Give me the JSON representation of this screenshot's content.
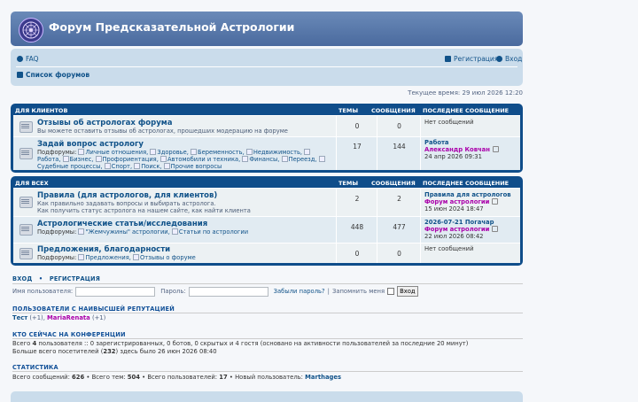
{
  "site": {
    "title": "Форум Предсказательной Астрологии"
  },
  "nav": {
    "faq": "FAQ",
    "register": "Регистрация",
    "login": "Вход",
    "forum_index": "Список форумов"
  },
  "current_time": "Текущее время: 29 июл 2026 12:20",
  "columns": {
    "topics": "ТЕМЫ",
    "posts": "СООБЩЕНИЯ",
    "last_post": "ПОСЛЕДНЕЕ СООБЩЕНИЕ"
  },
  "categories": [
    {
      "name": "ДЛЯ КЛИЕНТОВ",
      "forums": [
        {
          "title": "Отзывы об астрологах форума",
          "desc": "Вы можете оставить отзывы об астрологах, прошедших модерацию на форуме",
          "topics": "0",
          "posts": "0",
          "last": {
            "none": "Нет сообщений"
          }
        },
        {
          "title": "Задай вопрос астрологу",
          "subforums_label": "Подфорумы:",
          "subforums": [
            "Личные отношения,",
            "Здоровье,",
            "Беременность,",
            "Недвижимость,",
            "Работа,",
            "Бизнес,",
            "Профориентация,",
            "Автомобили и техника,",
            "Финансы,",
            "Переезд,",
            "Судебные процессы,",
            "Спорт,",
            "Поиск,",
            "Прочие вопросы"
          ],
          "topics": "17",
          "posts": "144",
          "last": {
            "topic": "Работа",
            "user": "Александр Ковчан",
            "date": "24 апр 2026 09:31"
          }
        }
      ]
    },
    {
      "name": "ДЛЯ ВСЕХ",
      "forums": [
        {
          "title": "Правила (для астрологов, для клиентов)",
          "desc": "Как правильно задавать вопросы и выбирать астролога.",
          "desc2": "Как получить статус астролога на нашем сайте, как найти клиента",
          "topics": "2",
          "posts": "2",
          "last": {
            "topic": "Правила для астрологов",
            "user": "Форум астрологии",
            "date": "15 июн 2024 18:47"
          }
        },
        {
          "title": "Астрологические статьи/исследования",
          "subforums_label": "Подфорумы:",
          "subforums": [
            "\"Жемчужины\" астрологии,",
            "Статьи по астрологии"
          ],
          "topics": "448",
          "posts": "477",
          "last": {
            "topic": "2026-07-21 Погачар",
            "user": "Форум астрологии",
            "date": "22 июл 2026 08:42"
          }
        },
        {
          "title": "Предложения, благодарности",
          "subforums_label": "Подфорумы:",
          "subforums": [
            "Предложения,",
            "Отзывы о форуме"
          ],
          "topics": "0",
          "posts": "0",
          "last": {
            "none": "Нет сообщений"
          }
        }
      ]
    }
  ],
  "login_box": {
    "login": "ВХОД",
    "dot": "•",
    "register": "РЕГИСТРАЦИЯ",
    "username_label": "Имя пользователя:",
    "password_label": "Пароль:",
    "forgot": "Забыли пароль?",
    "pipe": "|",
    "remember": "Запомнить меня",
    "submit": "Вход"
  },
  "reputation": {
    "heading": "ПОЛЬЗОВАТЕЛИ С НАИВЫСШЕЙ РЕПУТАЦИЕЙ",
    "user1": "Тест",
    "score1": "(+1),",
    "user2": "MariaRenata",
    "score2": "(+1)"
  },
  "online": {
    "heading": "КТО СЕЙЧАС НА КОНФЕРЕНЦИИ",
    "line1_a": "Всего",
    "line1_count": "4",
    "line1_b": "пользователя :: 0 зарегистрированных, 0 ботов, 0 скрытых и 4 гостя (основано на активности пользователей за последние 20 минут)",
    "line2_a": "Больше всего посетителей (",
    "line2_count": "232",
    "line2_b": ") здесь было 26 июн 2026 08:40"
  },
  "stats": {
    "heading": "СТАТИСТИКА",
    "posts_label": "Всего сообщений:",
    "posts": "626",
    "topics_label": "• Всего тем:",
    "topics": "504",
    "users_label": "• Всего пользователей:",
    "users": "17",
    "newest_label": "• Новый пользователь:",
    "newest": "Marthages"
  },
  "colors": {
    "header": "#4a6a9e",
    "category": "#0f4d8a",
    "link": "#105289",
    "user_purple": "#aa00aa"
  }
}
